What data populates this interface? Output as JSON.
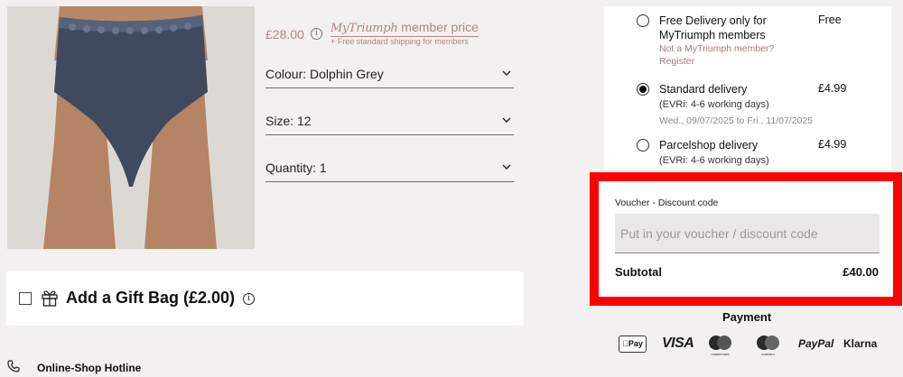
{
  "product": {
    "price": "£28.00",
    "member_brand": "MyTriumph",
    "member_suffix": "member price",
    "member_subtext": "+ Free standard shipping for members"
  },
  "selects": {
    "colour": "Colour: Dolphin Grey",
    "size": "Size: 12",
    "quantity": "Quantity: 1"
  },
  "gift_bag": {
    "label": "Add a Gift Bag (£2.00)",
    "checked": false
  },
  "hotline": {
    "label": "Online-Shop Hotline"
  },
  "delivery": {
    "options": [
      {
        "title_line1": "Free Delivery only for",
        "title_line2": "MyTriumph members",
        "price": "Free",
        "link_line1": "Not a MyTriumph member?",
        "link_line2": "Register",
        "selected": false
      },
      {
        "title": "Standard delivery",
        "price": "£4.99",
        "sub": "(EVRi: 4-6 working days)",
        "date": "Wed., 09/07/2025 to Fri., 11/07/2025",
        "selected": true
      },
      {
        "title": "Parcelshop delivery",
        "price": "£4.99",
        "sub": "(EVRi: 4-6 working days)",
        "selected": false
      }
    ]
  },
  "voucher": {
    "label": "Voucher - Discount code",
    "placeholder": "Put in your voucher / discount code",
    "value": ""
  },
  "summary": {
    "subtotal_label": "Subtotal",
    "subtotal_value": "£40.00"
  },
  "payment": {
    "title": "Payment",
    "applepay": "Pay",
    "visa": "VISA",
    "mastercard": "mastercard",
    "maestro": "maestro",
    "paypal": "PayPal",
    "klarna": "Klarna"
  },
  "colors": {
    "accent_highlight": "#ff0000",
    "member_price": "#b08782",
    "page_background": "#f2f1ef"
  }
}
